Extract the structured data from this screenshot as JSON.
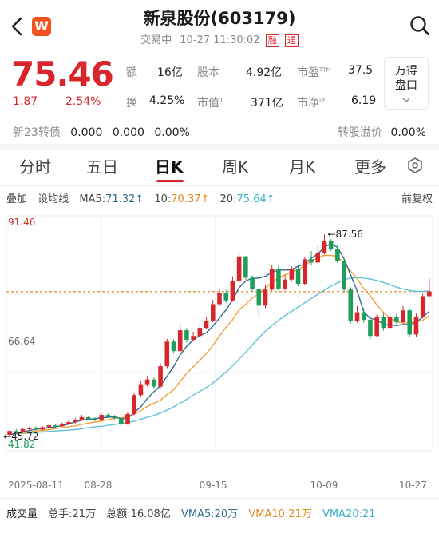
{
  "header": {
    "title": "新泉股份(603179)",
    "status": "交易中",
    "datetime": "10-27 11:30:02",
    "tags": [
      "融",
      "通"
    ],
    "logo_text": "W"
  },
  "quote": {
    "price": "75.46",
    "change": "1.87",
    "change_pct": "2.54%",
    "stats": [
      {
        "label": "额",
        "value": "16亿"
      },
      {
        "label": "股本",
        "value": "4.92亿"
      },
      {
        "label": "市盈",
        "sup": "TTM",
        "value": "37.5"
      },
      {
        "label": "换",
        "value": "4.25%"
      },
      {
        "label": "市值",
        "sup": "1",
        "value": "371亿"
      },
      {
        "label": "市净",
        "sup": "LF",
        "value": "6.19"
      }
    ],
    "panel_button": {
      "line1": "万得",
      "line2": "盘口",
      "icon": "chevron-down-icon"
    }
  },
  "bond": {
    "name": "新23转债",
    "v1": "0.000",
    "v2": "0.000",
    "v3": "0.00%",
    "premium_label": "转股溢价",
    "premium_value": "0.00%"
  },
  "tabs": [
    "分时",
    "五日",
    "日K",
    "周K",
    "月K",
    "更多"
  ],
  "active_tab": "日K",
  "ma_bar": {
    "overlay": "叠加",
    "line_setting": "设均线",
    "ma5_label": "MA5:",
    "ma5": "71.32",
    "ma10_label": "10:",
    "ma10": "70.37",
    "ma20_label": "20:",
    "ma20": "75.64",
    "adjust": "前复权"
  },
  "chart_data": {
    "type": "candlestick",
    "y_labels": {
      "top": "91.46",
      "mid": "66.64",
      "bottom": "41.82"
    },
    "ylim": [
      41.82,
      91.46
    ],
    "high_marker": "87.56",
    "low_marker": "45.72",
    "current_price": 75.46,
    "x_labels": [
      "2025-08-11",
      "08-28",
      "09-15",
      "10-09",
      "10-27"
    ],
    "candles": [
      [
        45.2,
        46.0,
        44.9,
        46.3
      ],
      [
        46.0,
        45.9,
        45.6,
        46.4
      ],
      [
        45.9,
        46.4,
        45.7,
        46.7
      ],
      [
        46.4,
        46.6,
        46.2,
        46.9
      ],
      [
        46.6,
        46.3,
        46.1,
        47.0
      ],
      [
        46.3,
        46.8,
        46.1,
        47.0
      ],
      [
        46.8,
        47.2,
        46.6,
        47.5
      ],
      [
        47.2,
        47.0,
        46.7,
        47.4
      ],
      [
        47.0,
        47.5,
        46.9,
        47.8
      ],
      [
        47.5,
        47.9,
        47.3,
        48.3
      ],
      [
        47.9,
        48.4,
        47.6,
        48.7
      ],
      [
        48.4,
        48.9,
        48.2,
        49.4
      ],
      [
        48.9,
        48.5,
        48.2,
        49.2
      ],
      [
        48.5,
        48.4,
        48.1,
        48.9
      ],
      [
        48.4,
        49.4,
        48.1,
        49.7
      ],
      [
        49.4,
        49.0,
        48.8,
        49.7
      ],
      [
        49.0,
        48.7,
        48.5,
        49.4
      ],
      [
        48.7,
        47.5,
        47.2,
        49.0
      ],
      [
        47.5,
        49.6,
        47.3,
        50.0
      ],
      [
        49.6,
        53.6,
        49.3,
        54.0
      ],
      [
        53.6,
        55.9,
        53.2,
        56.6
      ],
      [
        55.9,
        56.9,
        55.4,
        57.7
      ],
      [
        56.9,
        55.4,
        55.0,
        57.3
      ],
      [
        55.4,
        59.7,
        55.1,
        60.3
      ],
      [
        59.7,
        64.9,
        59.3,
        65.5
      ],
      [
        64.9,
        62.9,
        62.4,
        65.4
      ],
      [
        62.9,
        67.3,
        62.6,
        68.8
      ],
      [
        67.3,
        65.3,
        64.7,
        67.8
      ],
      [
        65.3,
        66.1,
        64.9,
        67.0
      ],
      [
        66.1,
        67.8,
        65.9,
        68.5
      ],
      [
        67.8,
        69.3,
        67.5,
        70.0
      ],
      [
        69.3,
        72.8,
        69.0,
        73.7
      ],
      [
        72.8,
        75.1,
        72.4,
        76.0
      ],
      [
        75.1,
        73.6,
        73.1,
        75.8
      ],
      [
        73.6,
        77.7,
        73.3,
        78.7
      ],
      [
        77.7,
        82.9,
        77.3,
        83.5
      ],
      [
        82.9,
        78.4,
        78.0,
        83.0
      ],
      [
        78.4,
        76.0,
        75.5,
        78.9
      ],
      [
        76.0,
        72.5,
        70.4,
        76.5
      ],
      [
        72.5,
        75.9,
        72.0,
        76.8
      ],
      [
        75.9,
        80.3,
        75.6,
        81.0
      ],
      [
        80.3,
        76.1,
        75.6,
        81.1
      ],
      [
        76.1,
        78.0,
        75.8,
        78.9
      ],
      [
        78.0,
        80.2,
        77.6,
        80.8
      ],
      [
        80.2,
        77.1,
        76.6,
        81.2
      ],
      [
        77.1,
        82.3,
        76.9,
        82.8
      ],
      [
        82.3,
        81.6,
        81.0,
        84.0
      ],
      [
        81.6,
        83.6,
        81.4,
        85.0
      ],
      [
        83.6,
        86.1,
        83.3,
        87.56
      ],
      [
        86.1,
        84.5,
        84.0,
        86.5
      ],
      [
        84.5,
        81.9,
        81.5,
        85.3
      ],
      [
        81.9,
        75.9,
        75.1,
        82.5
      ],
      [
        75.9,
        69.3,
        68.7,
        76.4
      ],
      [
        69.3,
        71.1,
        68.9,
        72.4
      ],
      [
        71.1,
        69.5,
        68.9,
        72.0
      ],
      [
        69.5,
        66.1,
        65.4,
        70.0
      ],
      [
        66.1,
        70.1,
        65.9,
        70.6
      ],
      [
        70.1,
        67.8,
        67.2,
        70.9
      ],
      [
        67.8,
        70.1,
        67.5,
        71.0
      ],
      [
        70.1,
        69.0,
        68.6,
        70.8
      ],
      [
        69.0,
        71.5,
        68.8,
        72.4
      ],
      [
        71.5,
        66.4,
        65.9,
        71.9
      ],
      [
        66.4,
        70.2,
        65.9,
        70.8
      ],
      [
        70.2,
        74.5,
        69.8,
        75.0
      ],
      [
        74.5,
        75.5,
        74.2,
        78.2
      ]
    ],
    "ma5": [
      45.3,
      45.5,
      45.8,
      46.1,
      46.4,
      46.5,
      46.7,
      46.9,
      47.1,
      47.5,
      47.9,
      48.3,
      48.5,
      48.6,
      48.8,
      48.9,
      49.0,
      48.6,
      48.7,
      49.9,
      51.1,
      52.9,
      54.3,
      55.6,
      57.6,
      59.6,
      62.1,
      63.9,
      65.3,
      66.2,
      66.8,
      68.2,
      69.9,
      71.6,
      73.7,
      76.3,
      77.7,
      78.3,
      78.3,
      78.7,
      79.5,
      80.1,
      80.0,
      80.1,
      80.8,
      81.3,
      82.5,
      83.4,
      84.9,
      85.6,
      84.8,
      82.4,
      79.0,
      75.6,
      71.2,
      69.8,
      69.5,
      68.6,
      68.4,
      68.3,
      68.5,
      68.5,
      69.0,
      70.1,
      71.3
    ],
    "ma10": [
      45.3,
      45.4,
      45.6,
      45.8,
      46.0,
      46.1,
      46.3,
      46.5,
      46.7,
      46.9,
      47.1,
      47.4,
      47.7,
      47.9,
      48.1,
      48.4,
      48.7,
      48.8,
      49.0,
      49.6,
      50.3,
      51.2,
      51.9,
      52.5,
      53.7,
      54.7,
      56.5,
      58.2,
      59.6,
      61.0,
      62.4,
      64.1,
      66.1,
      67.9,
      69.5,
      71.6,
      72.8,
      74.1,
      75.0,
      76.2,
      77.4,
      78.4,
      79.0,
      79.6,
      80.1,
      81.0,
      81.9,
      82.6,
      83.1,
      83.1,
      82.9,
      81.4,
      79.8,
      78.2,
      76.1,
      74.6,
      72.6,
      71.1,
      69.8,
      69.1,
      68.8,
      68.9,
      69.1,
      69.4,
      70.4
    ],
    "ma20": [
      45.3,
      45.4,
      45.5,
      45.6,
      45.7,
      45.8,
      45.9,
      46.0,
      46.1,
      46.2,
      46.3,
      46.5,
      46.7,
      46.9,
      47.0,
      47.2,
      47.4,
      47.6,
      47.8,
      48.1,
      48.5,
      48.9,
      49.3,
      49.8,
      50.4,
      51.1,
      51.9,
      52.7,
      53.6,
      54.4,
      55.2,
      56.2,
      57.3,
      58.5,
      59.8,
      61.2,
      62.7,
      64.2,
      65.7,
      67.1,
      68.3,
      69.4,
      70.4,
      71.3,
      72.2,
      73.1,
      74.0,
      74.9,
      75.8,
      76.6,
      77.3,
      78.0,
      78.3,
      78.4,
      78.3,
      78.1,
      77.8,
      77.4,
      76.9,
      76.4,
      76.0,
      75.7,
      75.5,
      75.5,
      75.6
    ]
  },
  "volume_bar": {
    "title": "成交量",
    "total_hands": "总手:21万",
    "total_amount": "总额:16.08亿",
    "vma5": "VMA5:20万",
    "vma10": "VMA10:21万",
    "vma20": "VMA20:21"
  },
  "colors": {
    "up": "#d8262c",
    "down": "#1f9d5a",
    "ma5": "#2e6b8f",
    "ma10": "#f0a23a",
    "ma20": "#5fc3d6",
    "price_line": "#e8892a",
    "accent": "#d8262c"
  }
}
